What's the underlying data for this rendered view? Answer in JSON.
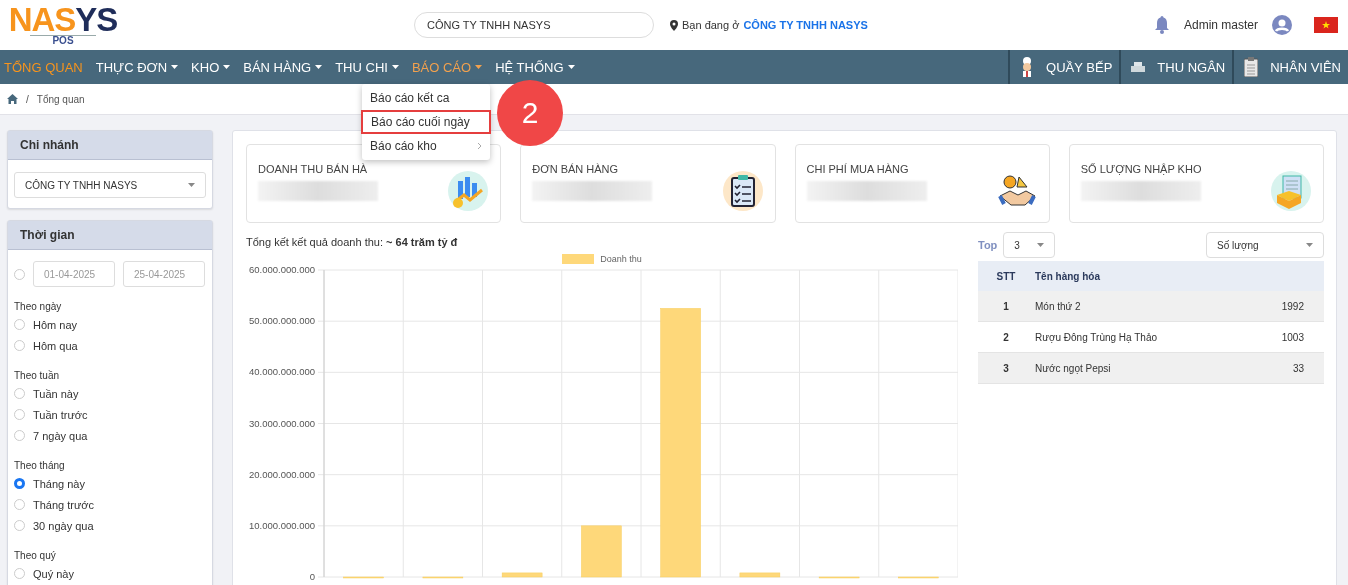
{
  "header": {
    "logo": [
      {
        "text": "NA",
        "color": "#f7941d"
      },
      {
        "text": "S",
        "color": "#f7941d"
      },
      {
        "text": "YS",
        "color": "#1f2d5a"
      }
    ],
    "logo_sub": "POS",
    "company_search": {
      "value": "CÔNG TY TNHH NASYS"
    },
    "location": {
      "label": "Bạn đang ở",
      "company": "CÔNG TY TNHH NASYS"
    },
    "user": "Admin master"
  },
  "nav": {
    "items": [
      {
        "label": "TỔNG QUAN",
        "selected": true,
        "dropdown": false,
        "expanded": false
      },
      {
        "label": "THỰC ĐƠN",
        "selected": false,
        "dropdown": true,
        "expanded": false
      },
      {
        "label": "KHO",
        "selected": false,
        "dropdown": true,
        "expanded": false
      },
      {
        "label": "BÁN HÀNG",
        "selected": false,
        "dropdown": true,
        "expanded": false
      },
      {
        "label": "THU CHI",
        "selected": false,
        "dropdown": true,
        "expanded": false
      },
      {
        "label": "BÁO CÁO",
        "selected": false,
        "dropdown": true,
        "expanded": true
      },
      {
        "label": "HỆ THỐNG",
        "selected": false,
        "dropdown": true,
        "expanded": false
      }
    ],
    "right": [
      {
        "label": "QUẦY BẾP",
        "kind": "chef"
      },
      {
        "label": "THU NGÂN",
        "kind": "register"
      },
      {
        "label": "NHÂN VIÊN",
        "kind": "clipboard"
      }
    ]
  },
  "dropdown_menu": {
    "items": [
      {
        "label": "Báo cáo kết ca",
        "highlighted": false,
        "submenu": false
      },
      {
        "label": "Báo cáo cuối ngày",
        "highlighted": true,
        "submenu": false
      },
      {
        "label": "Báo cáo kho",
        "highlighted": false,
        "submenu": true
      }
    ]
  },
  "callout": "2",
  "breadcrumb": {
    "separator": "/",
    "items": [
      "Tổng quan"
    ]
  },
  "branch_panel": {
    "title": "Chi nhánh",
    "select": "CÔNG TY TNHH NASYS"
  },
  "time_panel": {
    "title": "Thời gian",
    "range": {
      "selected": false,
      "from": "01-04-2025",
      "to": "25-04-2025"
    },
    "groups": [
      {
        "title": "Theo ngày",
        "options": [
          {
            "label": "Hôm nay",
            "selected": false
          },
          {
            "label": "Hôm qua",
            "selected": false
          }
        ]
      },
      {
        "title": "Theo tuần",
        "options": [
          {
            "label": "Tuần này",
            "selected": false
          },
          {
            "label": "Tuần trước",
            "selected": false
          },
          {
            "label": "7 ngày qua",
            "selected": false
          }
        ]
      },
      {
        "title": "Theo tháng",
        "options": [
          {
            "label": "Tháng này",
            "selected": true
          },
          {
            "label": "Tháng trước",
            "selected": false
          },
          {
            "label": "30 ngày qua",
            "selected": false
          }
        ]
      },
      {
        "title": "Theo quý",
        "options": [
          {
            "label": "Quý này",
            "selected": false
          }
        ]
      }
    ]
  },
  "stats": [
    {
      "title": "DOANH THU BÁN HÀ",
      "kind": "revenue"
    },
    {
      "title": "ĐƠN BÁN HÀNG",
      "kind": "orders"
    },
    {
      "title": "CHI PHÍ MUA HÀNG",
      "kind": "purchase"
    },
    {
      "title": "SỐ LƯỢNG NHẬP KHO",
      "kind": "stock"
    }
  ],
  "summary": "Tổng kết kết quả doanh thu: **~ 64 trăm tỷ đ**",
  "chart_data": {
    "type": "bar",
    "series": [
      {
        "name": "Doanh thu",
        "color": "#fed87a",
        "values": [
          0,
          0,
          800000000,
          10000000000,
          52500000000,
          800000000,
          0,
          0
        ]
      }
    ],
    "grid": true,
    "ylim": [
      0,
      60000000000
    ],
    "yticks": [
      {
        "value": 0,
        "label": "0"
      },
      {
        "value": 10000000000,
        "label": "10.000.000.000"
      },
      {
        "value": 20000000000,
        "label": "20.000.000.000"
      },
      {
        "value": 30000000000,
        "label": "30.000.000.000"
      },
      {
        "value": 40000000000,
        "label": "40.000.000.000"
      },
      {
        "value": 50000000000,
        "label": "50.000.000.000"
      },
      {
        "value": 60000000000,
        "label": "60.000.000.000"
      }
    ]
  },
  "top_products": {
    "top_label": "Top",
    "top_select": "3",
    "sort_select": "Số lượng",
    "columns": [
      "STT",
      "Tên hàng hóa"
    ],
    "rows": [
      {
        "stt": "1",
        "name": "Món thứ 2",
        "value": "1992"
      },
      {
        "stt": "2",
        "name": "Rượu Đông Trùng Hạ Thảo",
        "value": "1003"
      },
      {
        "stt": "3",
        "name": "Nước ngọt Pepsi",
        "value": "33"
      }
    ]
  }
}
